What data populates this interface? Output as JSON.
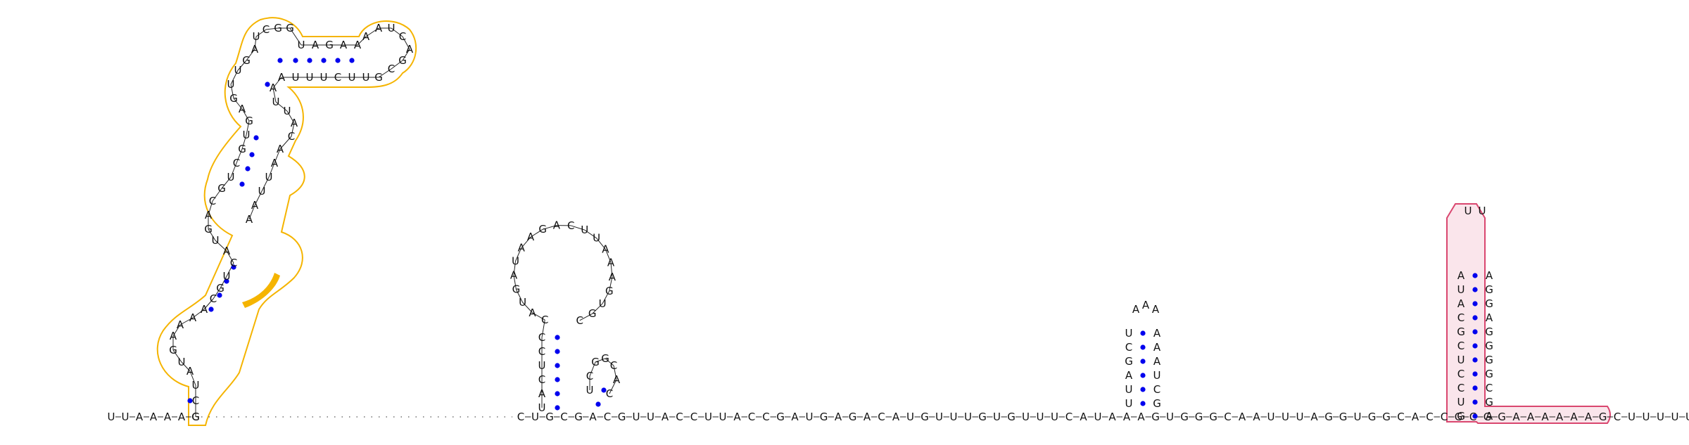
{
  "diagram": {
    "type": "rna-secondary-structure",
    "backbone_sequence": "UUAAAAGCUGCGACGUUACCUUACCGAUGAGACAUGUUUGUGUUUCAUAAAGUGGGCAAUUUAGGUGGCACCGCGGAAAAAAGCUUUUUUCUCU",
    "colors": {
      "nucleotide_text": "#111111",
      "backbone": "#222222",
      "dotted_gap": "#555555",
      "pair_dot": "#0000ee",
      "highlight_orange_stroke": "#f5b400",
      "highlight_orange_fill": "#f5b400",
      "highlight_pink_stroke": "#d9466f",
      "highlight_pink_fill": "#f7d3dd"
    },
    "highlights": [
      {
        "name": "orange-domain",
        "color": "#f5b400",
        "filled_segment": "CA"
      },
      {
        "name": "pink-domain",
        "color": "#d9466f"
      }
    ],
    "structures": [
      {
        "name": "stem-loop-left",
        "five_prime": "GCUAUGAAAACGUCAUGACGUCGUGAGUUGAUCGGUAGAAAAUCAGCGUUCUUUAAUUACAAUUAA",
        "three_prime": "C"
      },
      {
        "name": "stem-loop-middle",
        "five_prime": "UACUCCCAUGAUAAGACUUAAAGUGC",
        "loop": "UCGGCAC"
      },
      {
        "name": "small-hairpin",
        "stem": "UUAGCU",
        "loop": "AAA",
        "partner": "GCUAAA"
      },
      {
        "name": "stem-loop-right",
        "five_prime": "GUCCUCGCAUA",
        "loop": "UU",
        "three_prime": "AGCGGGGAGGA"
      }
    ]
  }
}
